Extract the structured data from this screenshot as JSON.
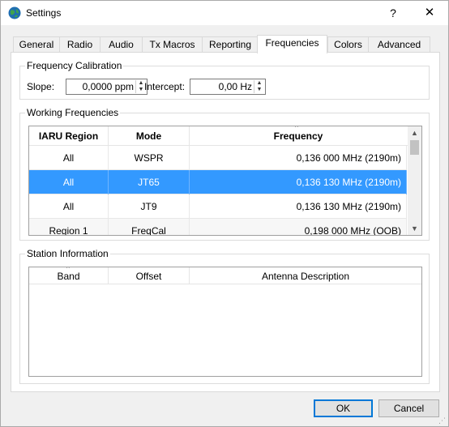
{
  "window": {
    "title": "Settings",
    "help_glyph": "?",
    "close_glyph": "✕"
  },
  "tabs": [
    {
      "label": "General"
    },
    {
      "label": "Radio"
    },
    {
      "label": "Audio"
    },
    {
      "label": "Tx Macros"
    },
    {
      "label": "Reporting"
    },
    {
      "label": "Frequencies"
    },
    {
      "label": "Colors"
    },
    {
      "label": "Advanced"
    }
  ],
  "active_tab": "Frequencies",
  "calibration": {
    "title": "Frequency Calibration",
    "slope_label": "Slope:",
    "slope_value": "0,0000 ppm",
    "intercept_label": "Intercept:",
    "intercept_value": "0,00 Hz"
  },
  "working": {
    "title": "Working Frequencies",
    "columns": [
      "IARU Region",
      "Mode",
      "Frequency"
    ],
    "rows": [
      {
        "region": "All",
        "mode": "WSPR",
        "frequency": "0,136 000 MHz (2190m)"
      },
      {
        "region": "All",
        "mode": "JT65",
        "frequency": "0,136 130 MHz (2190m)"
      },
      {
        "region": "All",
        "mode": "JT9",
        "frequency": "0,136 130 MHz (2190m)"
      },
      {
        "region": "Region 1",
        "mode": "FreqCal",
        "frequency": "0,198 000 MHz (OOB)"
      }
    ],
    "selected_row": 1
  },
  "station": {
    "title": "Station Information",
    "columns": [
      "Band",
      "Offset",
      "Antenna Description"
    ]
  },
  "buttons": {
    "ok": "OK",
    "cancel": "Cancel"
  },
  "icons": {
    "spin_up": "▲",
    "spin_down": "▼",
    "scroll_up": "▲",
    "scroll_down": "▼",
    "sort": "^"
  },
  "colors": {
    "selection": "#3399ff",
    "default_button_border": "#0078d7"
  }
}
